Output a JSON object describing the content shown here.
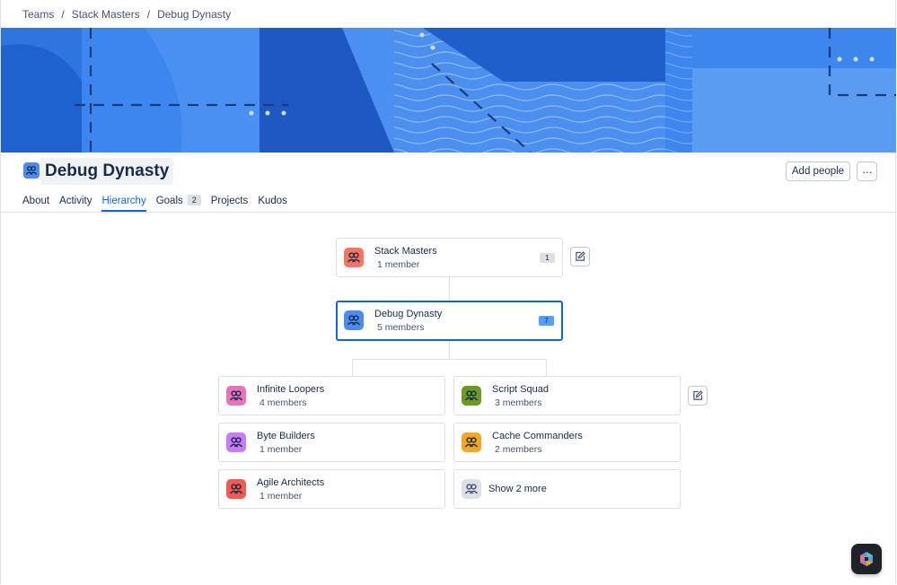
{
  "breadcrumb": {
    "items": [
      "Teams",
      "Stack Masters",
      "Debug Dynasty"
    ],
    "separator": "/"
  },
  "header": {
    "title": "Debug Dynasty",
    "add_people_label": "Add people",
    "more_label": "···"
  },
  "tabs": [
    {
      "label": "About"
    },
    {
      "label": "Activity"
    },
    {
      "label": "Hierarchy",
      "active": true
    },
    {
      "label": "Goals",
      "count": "2"
    },
    {
      "label": "Projects"
    },
    {
      "label": "Kudos"
    }
  ],
  "hierarchy": {
    "parent": {
      "name": "Stack Masters",
      "members": "1 member",
      "badge": "1",
      "color": "#f87462"
    },
    "current": {
      "name": "Debug Dynasty",
      "members": "5 members",
      "badge": "7",
      "color": "#4c8cf0"
    },
    "children": [
      {
        "name": "Infinite Loopers",
        "members": "4 members",
        "color": "#e774bb"
      },
      {
        "name": "Script Squad",
        "members": "3 members",
        "color": "#6a9a23"
      },
      {
        "name": "Byte Builders",
        "members": "1 member",
        "color": "#c97cf4"
      },
      {
        "name": "Cache Commanders",
        "members": "2 members",
        "color": "#f5a623"
      },
      {
        "name": "Agile Architects",
        "members": "1 member",
        "color": "#f15b50"
      }
    ],
    "show_more_label": "Show 2 more"
  },
  "icons": {
    "team": "team-icon",
    "edit": "edit-icon",
    "more": "more-icon",
    "help": "help-icon"
  },
  "colors": {
    "accent": "#0c66e4",
    "banner": "#2a6fdb"
  }
}
